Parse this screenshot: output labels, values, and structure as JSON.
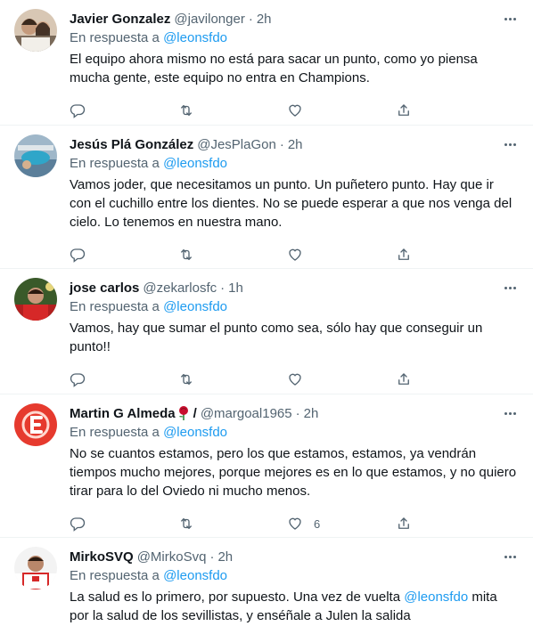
{
  "reply_prefix": "En respuesta a",
  "tweets": [
    {
      "name": "Javier Gonzalez",
      "handle": "@javilonger",
      "separator": "·",
      "time": "2h",
      "reply_to": "@leonsfdo",
      "text": "El equipo ahora mismo no está para sacar un punto, como yo piensa mucha gente, este equipo no entra en Champions.",
      "like_count": ""
    },
    {
      "name": "Jesús Plá González",
      "handle": "@JesPlaGon",
      "separator": "·",
      "time": "2h",
      "reply_to": "@leonsfdo",
      "text": "Vamos joder, que necesitamos un punto. Un puñetero punto. Hay que ir con el cuchillo entre los dientes. No se puede esperar a que nos venga del cielo. Lo tenemos en nuestra mano.",
      "like_count": ""
    },
    {
      "name": "jose carlos",
      "handle": "@zekarlosfc",
      "separator": "·",
      "time": "1h",
      "reply_to": "@leonsfdo",
      "text": "Vamos, hay que sumar el punto como sea, sólo hay que conseguir un punto!!",
      "like_count": ""
    },
    {
      "name": "Martin G Almeda",
      "name_suffix": "/",
      "handle": "@margoal1965",
      "separator": "·",
      "time": "2h",
      "reply_to": "@leonsfdo",
      "text": "No se cuantos estamos, pero los que estamos, estamos, ya vendrán tiempos mucho mejores, porque mejores es en lo que estamos, y no quiero tirar para lo del Oviedo ni mucho menos.",
      "like_count": "6"
    },
    {
      "name": "MirkoSVQ",
      "handle": "@MirkoSvq",
      "separator": "·",
      "time": "2h",
      "reply_to": "@leonsfdo",
      "text_before": "La salud es lo primero, por supuesto. Una vez de vuelta ",
      "text_mention": "@leonsfdo",
      "text_after": " mita por la salud de los sevillistas, y enséñale a Julen la salida",
      "like_count": ""
    }
  ],
  "icons": [
    "reply-icon",
    "retweet-icon",
    "like-icon",
    "share-icon",
    "more-icon",
    "rose-icon"
  ],
  "colors": {
    "text": "#0f1419",
    "secondary": "#536471",
    "link": "#1d9bf0",
    "border": "#eff3f4"
  }
}
